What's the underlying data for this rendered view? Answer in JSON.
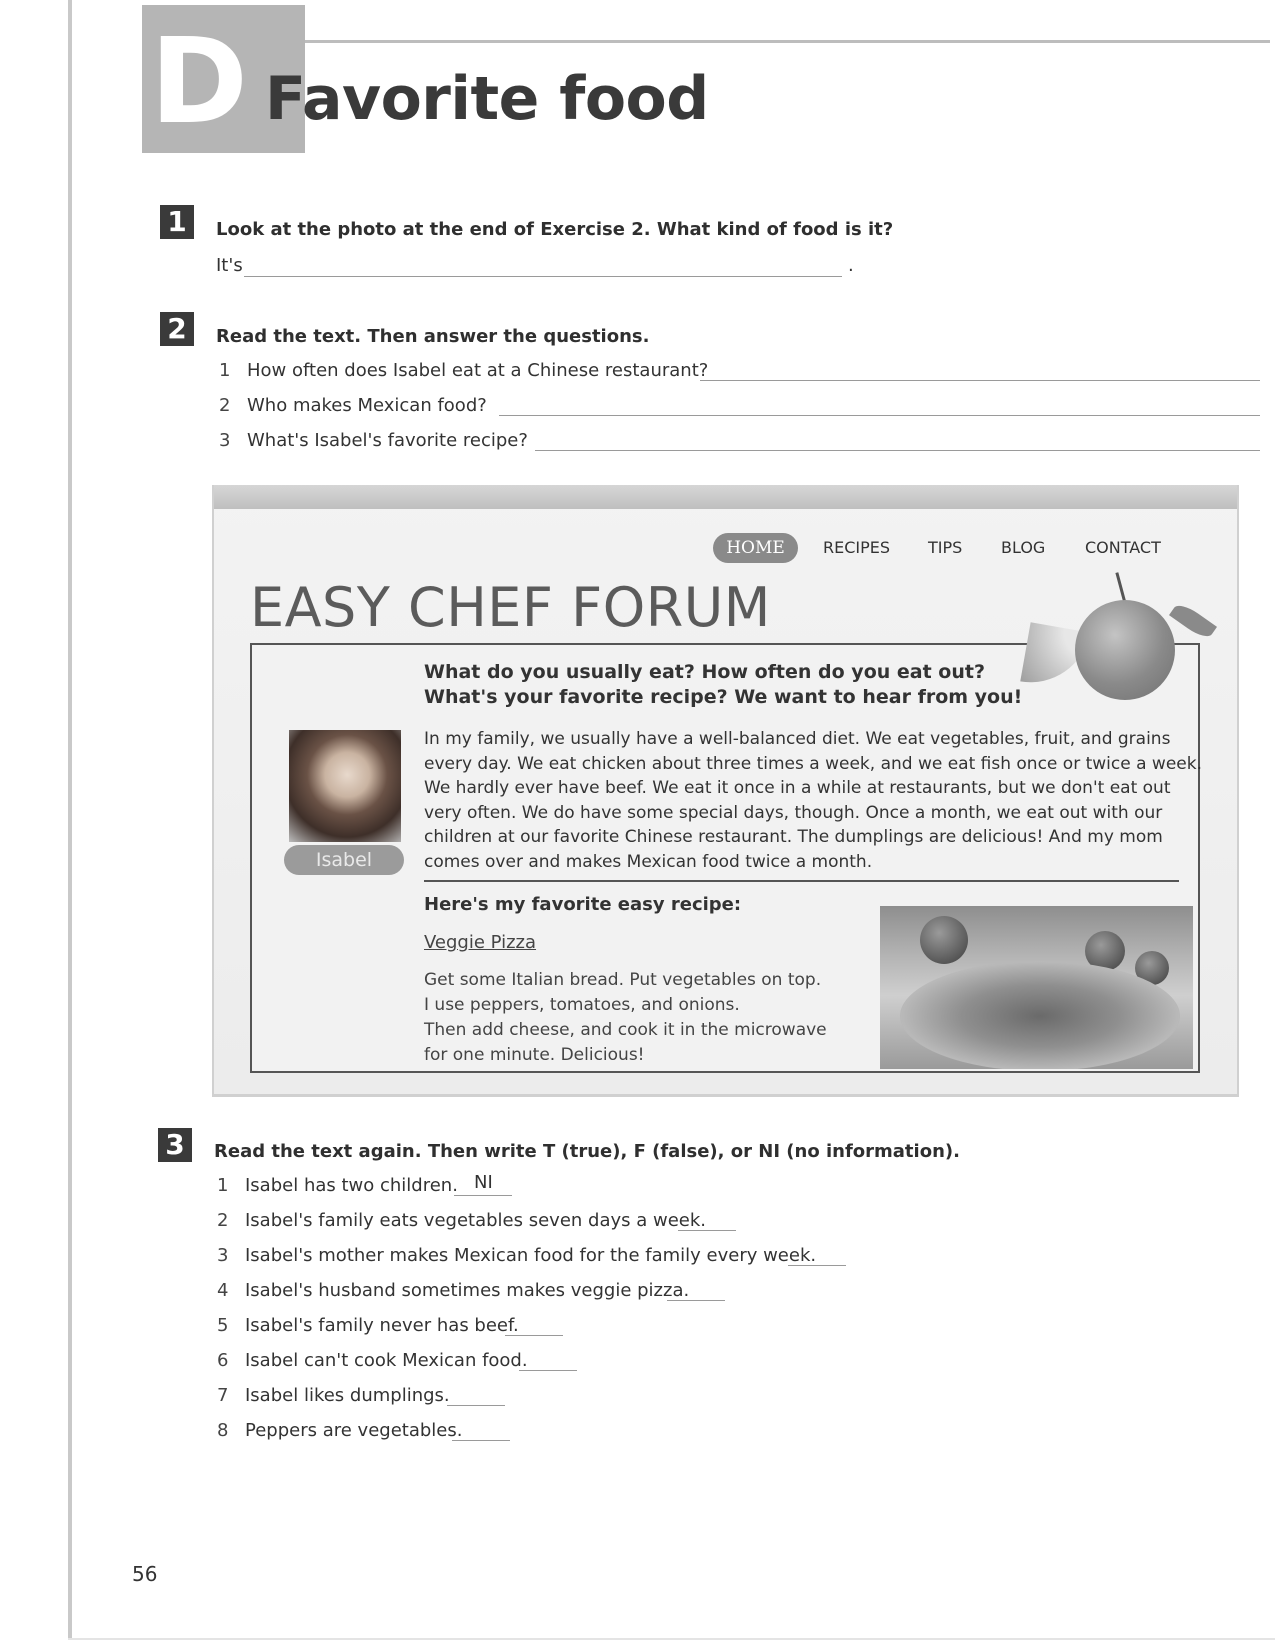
{
  "header": {
    "section_letter": "D",
    "title": "Favorite food"
  },
  "exercise1": {
    "number": "1",
    "instruction": "Look at the photo at the end of Exercise 2. What kind of food is it?",
    "answer_prefix": "It's",
    "answer_suffix": "."
  },
  "exercise2": {
    "number": "2",
    "instruction": "Read the text. Then answer the questions.",
    "questions": [
      {
        "num": "1",
        "text": "How often does Isabel eat at a Chinese restaurant?"
      },
      {
        "num": "2",
        "text": "Who makes Mexican food?"
      },
      {
        "num": "3",
        "text": "What's Isabel's favorite recipe?"
      }
    ]
  },
  "forum": {
    "nav": [
      "HOME",
      "RECIPES",
      "TIPS",
      "BLOG",
      "CONTACT"
    ],
    "title": "EASY CHEF FORUM",
    "questions_line1": "What do you usually eat? How often do you eat out?",
    "questions_line2": "What's your favorite recipe? We want to hear from you!",
    "author": "Isabel",
    "paragraph_lines": [
      "In my family, we usually have a well-balanced diet. We eat vegetables, fruit, and grains",
      "every day. We eat chicken about three times a week, and we eat fish once or twice a week.",
      "We hardly ever have beef. We eat it once in a while at restaurants, but we don't eat out",
      "very often. We do have some special days, though. Once a month, we eat out with our",
      "children at our favorite Chinese restaurant. The dumplings are delicious! And my mom",
      "comes over and makes Mexican food twice a month."
    ],
    "recipe_heading": "Here's my favorite easy recipe:",
    "recipe_name": "Veggie Pizza",
    "recipe_lines": [
      "Get some Italian bread. Put vegetables on top.",
      "I use peppers, tomatoes, and onions.",
      "Then add cheese, and cook it in the microwave",
      "for one minute. Delicious!"
    ]
  },
  "exercise3": {
    "number": "3",
    "instruction": "Read the text again. Then write T (true), F (false), or NI (no information).",
    "statements": [
      {
        "num": "1",
        "text": "Isabel has two children.",
        "answer": "NI"
      },
      {
        "num": "2",
        "text": "Isabel's family eats vegetables seven days a week.",
        "answer": ""
      },
      {
        "num": "3",
        "text": "Isabel's mother makes Mexican food for the family every week.",
        "answer": ""
      },
      {
        "num": "4",
        "text": "Isabel's husband sometimes makes veggie pizza.",
        "answer": ""
      },
      {
        "num": "5",
        "text": "Isabel's family never has beef.",
        "answer": ""
      },
      {
        "num": "6",
        "text": "Isabel can't cook Mexican food.",
        "answer": ""
      },
      {
        "num": "7",
        "text": "Isabel likes dumplings.",
        "answer": ""
      },
      {
        "num": "8",
        "text": "Peppers are vegetables.",
        "answer": ""
      }
    ]
  },
  "page_number": "56",
  "icons": {
    "orange": "orange-fruit-icon",
    "isabel_photo": "portrait-photo",
    "pizza_photo": "pizza-photo"
  }
}
